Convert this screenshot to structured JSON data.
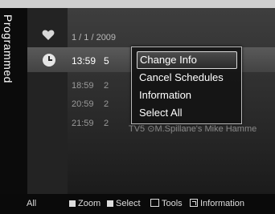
{
  "sidebar": {
    "tab_label": "Programmed"
  },
  "header": {
    "date": "1 / 1 / 2009"
  },
  "schedules": [
    {
      "time": "13:59",
      "channel": "5",
      "selected": true
    },
    {
      "time": "18:59",
      "channel": "2"
    },
    {
      "time": "20:59",
      "channel": "2"
    },
    {
      "time": "21:59",
      "channel": "2",
      "title": "TV5  ⊙M.Spillane's Mike Hamme"
    }
  ],
  "context_menu": {
    "items": [
      "Change Info",
      "Cancel Schedules",
      "Information",
      "Select All"
    ],
    "focused_index": 0
  },
  "footer": {
    "mode": "All",
    "zoom": "Zoom",
    "select": "Select",
    "tools": "Tools",
    "information": "Information"
  },
  "colors": {
    "highlight": "#4e4e4e",
    "popup_border": "#bbbbbb",
    "background": "#1a1a1a"
  },
  "icons": [
    "heart-icon",
    "clock-icon",
    "square-icon",
    "tools-icon",
    "info-icon"
  ]
}
